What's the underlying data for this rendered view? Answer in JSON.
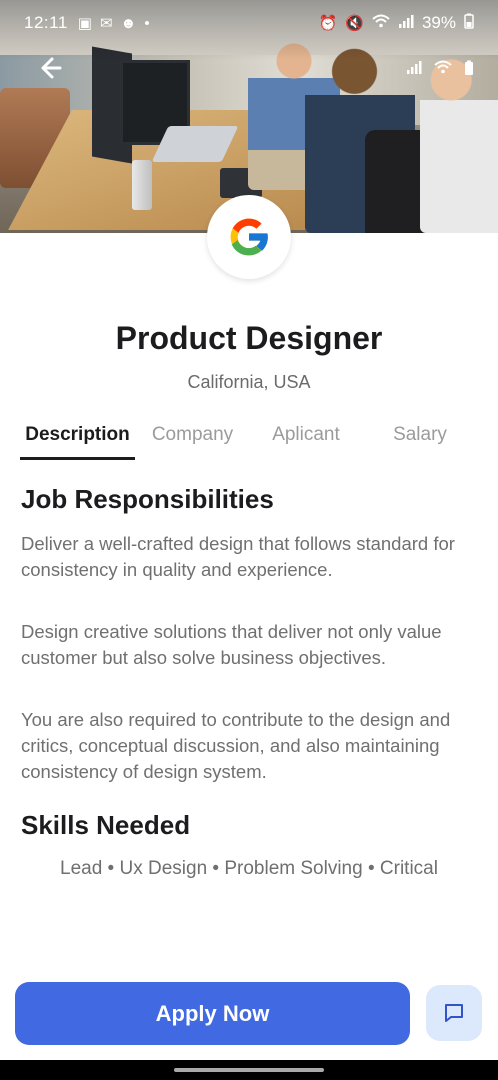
{
  "status_bar": {
    "time": "12:11",
    "battery_percent": "39%",
    "left_icons": [
      "gallery-icon",
      "outlook-icon",
      "snapchat-icon",
      "dot-icon"
    ],
    "right_icons": [
      "alarm-icon",
      "mute-icon",
      "wifi-icon",
      "signal-icon"
    ]
  },
  "job": {
    "title": "Product Designer",
    "location": "California, USA",
    "company_logo": "google-logo"
  },
  "tabs": [
    {
      "label": "Description",
      "active": true
    },
    {
      "label": "Company",
      "active": false
    },
    {
      "label": "Aplicant",
      "active": false
    },
    {
      "label": "Salary",
      "active": false
    }
  ],
  "description": {
    "heading": "Job Responsibilities",
    "paragraphs": [
      "Deliver a well-crafted design that follows standard for consistency in quality and experience.",
      "Design creative solutions that deliver not only value customer but also solve business objectives.",
      "You are also required to contribute to the design and critics, conceptual discussion, and also maintaining consistency of design system."
    ]
  },
  "skills": {
    "heading": "Skills Needed",
    "list": "Lead • Ux Design • Problem Solving • Critical"
  },
  "actions": {
    "apply_label": "Apply Now",
    "chat_icon": "chat-icon"
  },
  "colors": {
    "primary": "#4169e1",
    "chat_button_bg": "#dce8fb",
    "title_text": "#1c1c1e",
    "muted_text": "#707070"
  }
}
